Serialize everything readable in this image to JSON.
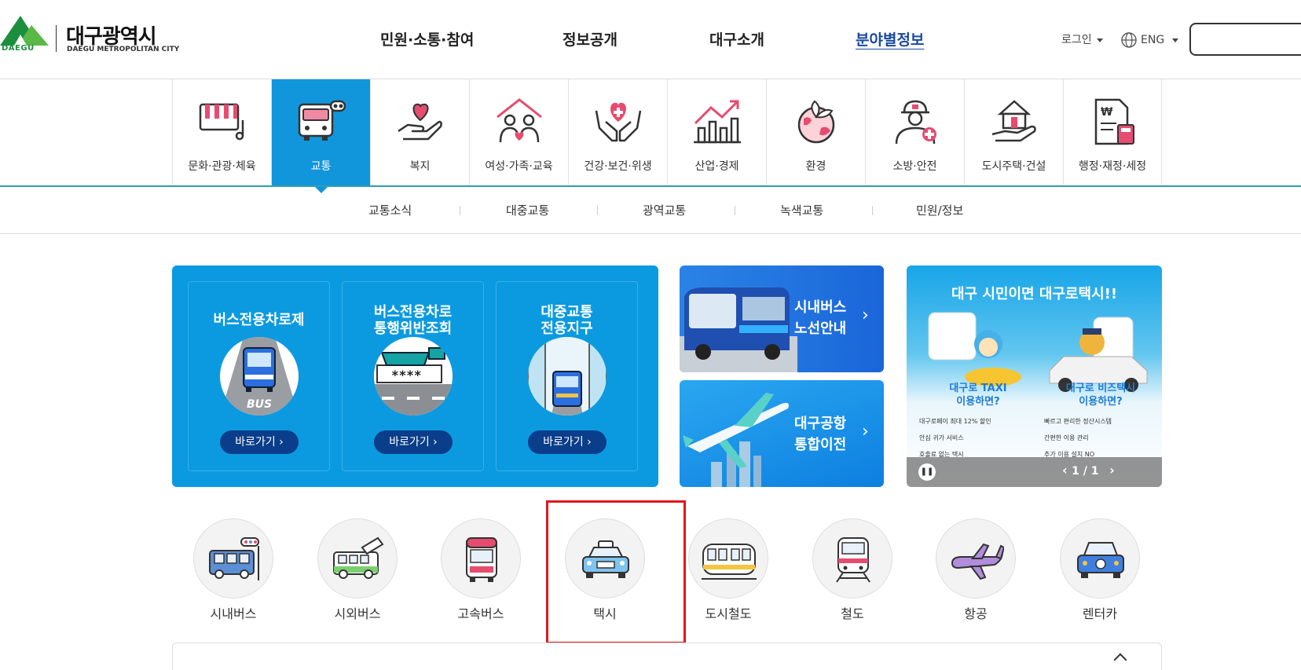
{
  "header": {
    "logo": {
      "small_en": "DAEGU",
      "name_ko": "대구광역시",
      "name_en": "DAEGU METROPOLITAN CITY"
    },
    "gnb": [
      "민원·소통·참여",
      "정보공개",
      "대구소개",
      "분야별정보"
    ],
    "login": "로그인",
    "language": "ENG",
    "search_placeholder": ""
  },
  "categories": [
    {
      "label": "문화·관광·체육",
      "icon": "piano-icon"
    },
    {
      "label": "교통",
      "icon": "bus-icon",
      "active": true
    },
    {
      "label": "복지",
      "icon": "heart-hand-icon"
    },
    {
      "label": "여성·가족·교육",
      "icon": "family-house-icon"
    },
    {
      "label": "건강·보건·위생",
      "icon": "health-hands-icon"
    },
    {
      "label": "산업·경제",
      "icon": "growth-chart-icon"
    },
    {
      "label": "환경",
      "icon": "earth-leaf-icon"
    },
    {
      "label": "소방·안전",
      "icon": "firefighter-icon"
    },
    {
      "label": "도시주택·건설",
      "icon": "house-hand-icon"
    },
    {
      "label": "행정·재정·세정",
      "icon": "tax-document-icon"
    }
  ],
  "subnav": [
    "교통소식",
    "대중교통",
    "광역교통",
    "녹색교통",
    "민원/정보"
  ],
  "feature_cards": [
    {
      "title_line1": "버스전용차로제",
      "title_line2": "",
      "button": "바로가기",
      "badge": "BUS"
    },
    {
      "title_line1": "버스전용차로",
      "title_line2": "통행위반조회",
      "button": "바로가기",
      "badge": "****"
    },
    {
      "title_line1": "대중교통",
      "title_line2": "전용지구",
      "button": "바로가기"
    }
  ],
  "tiles": [
    {
      "line1": "시내버스",
      "line2": "노선안내"
    },
    {
      "line1": "대구공항",
      "line2": "통합이전"
    }
  ],
  "banner": {
    "title": "대구 시민이면 대구로택시!!",
    "left_heading": "대구로 TAXI\n이용하면?",
    "right_heading": "대구로 비즈택시\n이용하면?",
    "left_points": [
      "대구로페이 최대 12% 할인",
      "안심 귀가 서비스",
      "호출료 없는 택시"
    ],
    "right_points": [
      "빠르고 편리한 정산시스템",
      "간편한 이용 관리",
      "추가 이용 설치 NO"
    ],
    "pager": "1 / 1"
  },
  "modes": [
    {
      "label": "시내버스",
      "icon": "city-bus-icon"
    },
    {
      "label": "시외버스",
      "icon": "intercity-bus-icon"
    },
    {
      "label": "고속버스",
      "icon": "express-bus-icon"
    },
    {
      "label": "택시",
      "icon": "taxi-icon",
      "highlighted": true
    },
    {
      "label": "도시철도",
      "icon": "subway-icon"
    },
    {
      "label": "철도",
      "icon": "train-icon"
    },
    {
      "label": "항공",
      "icon": "airplane-icon"
    },
    {
      "label": "렌터카",
      "icon": "rental-car-icon"
    }
  ],
  "colors": {
    "primary": "#0b9ae0",
    "active_tab": "#1296db",
    "highlight": "#e0161d",
    "button_dark": "#0a3e8a"
  }
}
